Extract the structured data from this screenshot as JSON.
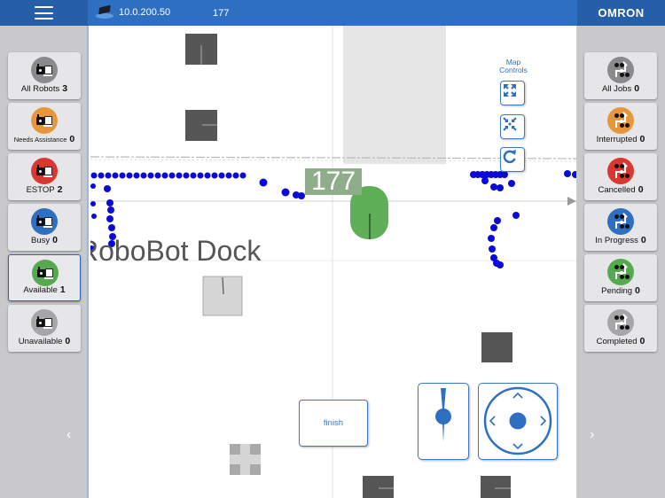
{
  "topbar": {
    "menu_icon": "hamburger-menu-icon",
    "device_icon": "robot-connection-icon",
    "ip_address": "10.0.200.50",
    "robot_id": "177",
    "brand": "OMRON"
  },
  "robots_panel": {
    "items": [
      {
        "label": "All Robots",
        "count": "3",
        "color": "#8a8a8c",
        "selected": false
      },
      {
        "label": "Needs Assistance",
        "count": "0",
        "color": "#e8963a",
        "selected": false
      },
      {
        "label": "ESTOP",
        "count": "2",
        "color": "#d8382f",
        "selected": false
      },
      {
        "label": "Busy",
        "count": "0",
        "color": "#2f6fc2",
        "selected": false
      },
      {
        "label": "Available",
        "count": "1",
        "color": "#56a94e",
        "selected": true
      },
      {
        "label": "Unavailable",
        "count": "0",
        "color": "#a6a6a8",
        "selected": false
      }
    ],
    "nav_arrow": "‹"
  },
  "jobs_panel": {
    "items": [
      {
        "label": "All Jobs",
        "count": "0",
        "color": "#8a8a8c"
      },
      {
        "label": "Interrupted",
        "count": "0",
        "color": "#e8963a"
      },
      {
        "label": "Cancelled",
        "count": "0",
        "color": "#d8382f"
      },
      {
        "label": "In Progress",
        "count": "0",
        "color": "#2f6fc2"
      },
      {
        "label": "Pending",
        "count": "0",
        "color": "#56a94e"
      },
      {
        "label": "Completed",
        "count": "0",
        "color": "#a6a6a8"
      }
    ],
    "nav_arrow": "›"
  },
  "map": {
    "controls_title": "Map Controls",
    "controls": [
      "expand-icon",
      "collapse-icon",
      "refresh-icon"
    ],
    "dock_label": "RoboBot Dock",
    "robot_tag": "177",
    "robot_color": "#5fae58",
    "path_color": "#0a0ad8",
    "finish_label": "finish",
    "heading_control": "heading-slider-icon",
    "drive_control": "drive-joystick-icon"
  }
}
